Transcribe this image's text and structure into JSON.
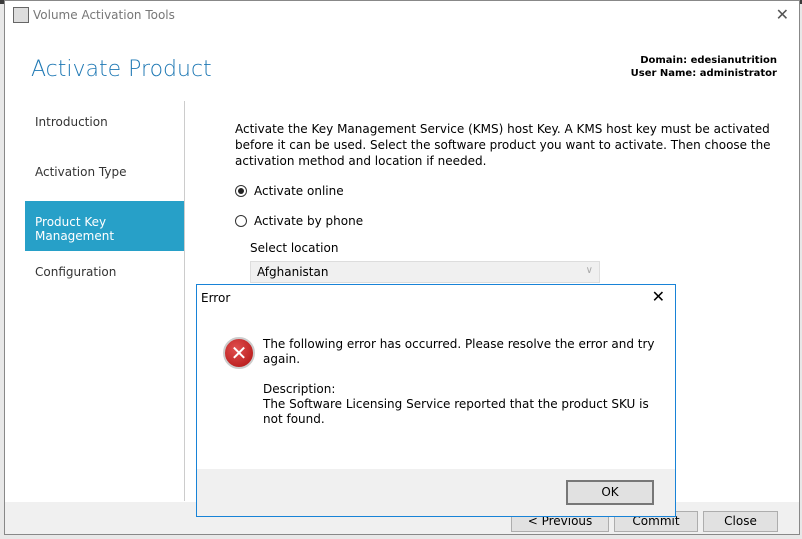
{
  "window": {
    "title": "Volume Activation Tools",
    "close_glyph": "✕"
  },
  "header": {
    "page_title": "Activate Product",
    "domain": "Domain: edesianutrition",
    "user": "User Name: administrator"
  },
  "nav": {
    "items": [
      {
        "label": "Introduction"
      },
      {
        "label": "Activation Type"
      },
      {
        "label": "Product Key Management",
        "active": true
      },
      {
        "label": "Configuration"
      }
    ]
  },
  "content": {
    "description": "Activate the Key Management Service (KMS) host Key. A KMS host key must be activated before it can be used. Select the software product you want to activate. Then choose the activation method and location if needed.",
    "radios": [
      {
        "label": "Activate online",
        "checked": true
      },
      {
        "label": "Activate by phone",
        "checked": false
      }
    ],
    "location_label": "Select location",
    "location_value": "Afghanistan"
  },
  "footer": {
    "previous": "< Previous",
    "commit": "Commit",
    "close": "Close"
  },
  "dialog": {
    "title": "Error",
    "close_glyph": "✕",
    "icon": "error-icon",
    "message": "The following error has occurred. Please resolve the error and try again.",
    "description_label": "Description:",
    "description": "The Software Licensing Service reported that the product SKU is not found.",
    "ok": "OK"
  },
  "colors": {
    "accent": "#27a0c8",
    "title": "#1e78b4",
    "dialog_border": "#1883d7"
  }
}
